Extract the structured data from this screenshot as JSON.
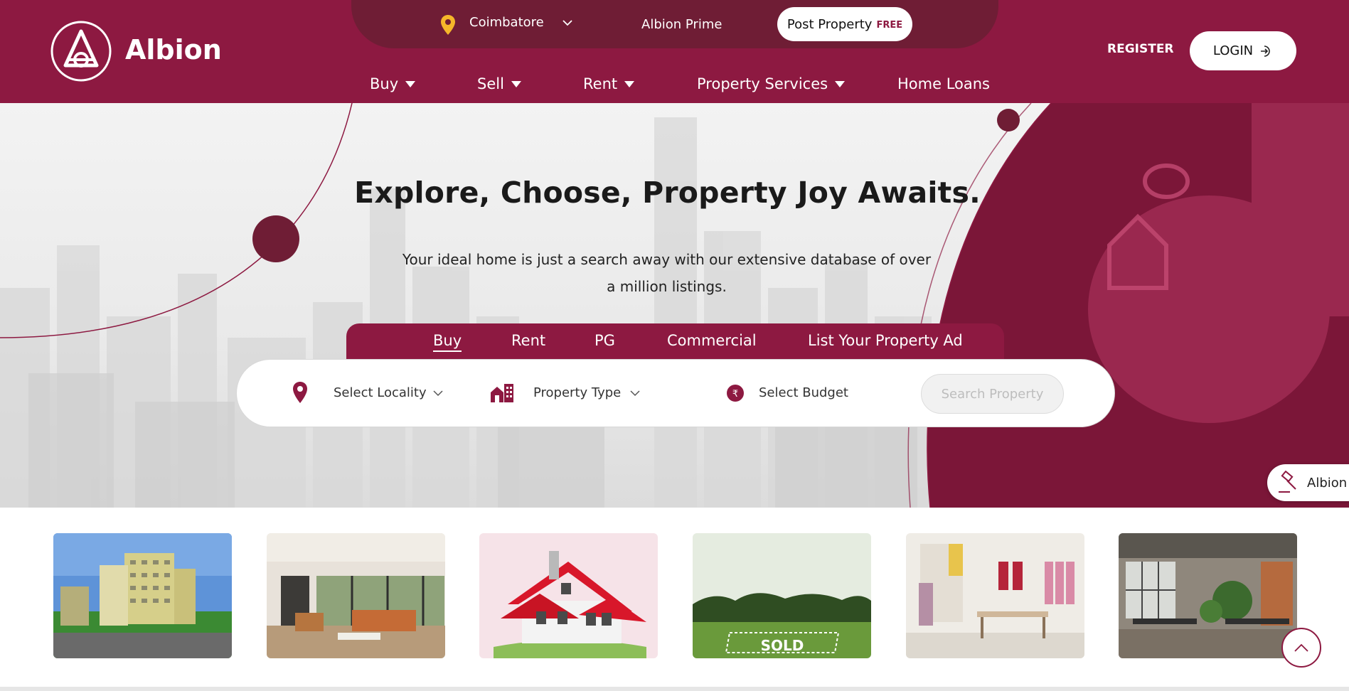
{
  "brand": {
    "name": "Albion"
  },
  "topbar": {
    "city": "Coimbatore",
    "prime": "Albion Prime",
    "post_property": "Post Property",
    "post_property_badge": "FREE"
  },
  "auth": {
    "register": "REGISTER",
    "login": "LOGIN"
  },
  "nav": [
    {
      "label": "Buy"
    },
    {
      "label": "Sell"
    },
    {
      "label": "Rent"
    },
    {
      "label": "Property Services"
    },
    {
      "label": "Home Loans"
    }
  ],
  "hero": {
    "title": "Explore, Choose, Property Joy Awaits.",
    "subtitle": "Your ideal home is just a search away with our extensive database of over a million listings."
  },
  "search_tabs": [
    {
      "label": "Buy",
      "active": true
    },
    {
      "label": "Rent"
    },
    {
      "label": "PG"
    },
    {
      "label": "Commercial"
    },
    {
      "label": "List Your Property Ad"
    }
  ],
  "search": {
    "locality": "Select Locality",
    "property_type": "Property Type",
    "budget": "Select Budget",
    "button": "Search Property"
  },
  "side_badge": {
    "label": "Albion"
  },
  "cards": [
    {
      "name": "apartment-building"
    },
    {
      "name": "living-room"
    },
    {
      "name": "house"
    },
    {
      "name": "sold-land",
      "overlay": "SOLD"
    },
    {
      "name": "retail-store"
    },
    {
      "name": "office-space"
    }
  ],
  "colors": {
    "primary": "#8d1941",
    "topbar": "#6f1d35",
    "accent_pin": "#f5b62a"
  }
}
